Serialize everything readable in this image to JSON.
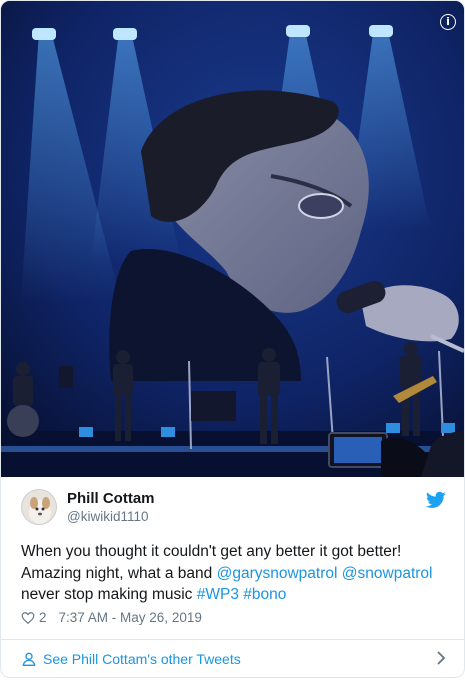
{
  "media": {
    "alt": "",
    "icons": {
      "info": "info-icon"
    }
  },
  "tweet": {
    "author_name": "Phill Cottam",
    "author_handle": "@kiwikid1110",
    "text_parts": [
      "When you thought it couldn't get any better it got better! Amazing night, what a band ",
      "@garysnowpatrol",
      " ",
      "@snowpatrol",
      " never stop making music ",
      "#WP3",
      " ",
      "#bono"
    ],
    "like_count": "2",
    "timestamp": "7:37 AM - May 26, 2019",
    "footer_link": "See Phill Cottam's other Tweets"
  },
  "colors": {
    "link": "#1b95e0",
    "secondary_text": "#657786",
    "primary_text": "#14171a",
    "twitter_blue": "#1da1f2",
    "border": "#e1e8ed"
  }
}
